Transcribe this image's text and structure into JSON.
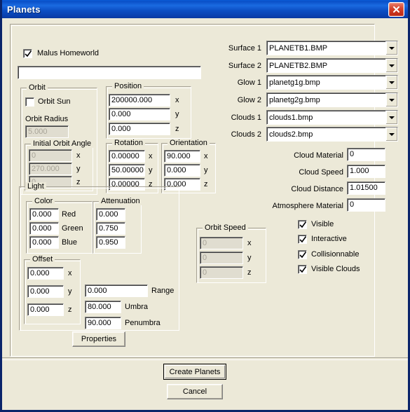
{
  "window": {
    "title": "Planets",
    "close_icon": "close-icon",
    "titlebar_color": "#0a50c8",
    "face_color": "#ece9d8"
  },
  "main": {
    "homeworld_checkbox": {
      "label": "Malus Homeworld",
      "checked": true
    },
    "name_field": {
      "value": "",
      "placeholder": ""
    },
    "orbit": {
      "legend": "Orbit",
      "orbit_sun": {
        "label": "Orbit Sun",
        "checked": false
      },
      "orbit_radius_label": "Orbit Radius",
      "orbit_radius_value": "5.000",
      "orbit_radius_disabled": true,
      "initial_orbit_angle": {
        "legend": "Initial Orbit Angle",
        "disabled": true,
        "axes": [
          "x",
          "y",
          "z"
        ],
        "values": [
          "0",
          "270.000",
          "0"
        ]
      }
    },
    "position": {
      "legend": "Position",
      "axes": [
        "x",
        "y",
        "z"
      ],
      "values": [
        "200000.000",
        "0.000",
        "0.000"
      ]
    },
    "rotation": {
      "legend": "Rotation",
      "axes": [
        "x",
        "y",
        "z"
      ],
      "values": [
        "0.00000",
        "50.00000",
        "0.00000"
      ]
    },
    "orientation": {
      "legend": "Orientation",
      "axes": [
        "x",
        "y",
        "z"
      ],
      "values": [
        "90.000",
        "0.000",
        "0.000"
      ]
    },
    "light": {
      "legend": "Light",
      "color": {
        "legend": "Color",
        "labels": [
          "Red",
          "Green",
          "Blue"
        ],
        "values": [
          "0.000",
          "0.000",
          "0.000"
        ]
      },
      "attenuation": {
        "legend": "Attenuation",
        "values": [
          "0.000",
          "0.750",
          "0.950"
        ]
      },
      "offset": {
        "legend": "Offset",
        "axes": [
          "x",
          "y",
          "z"
        ],
        "values": [
          "0.000",
          "0.000",
          "0.000"
        ]
      },
      "range": {
        "label": "Range",
        "value": "0.000"
      },
      "umbra": {
        "label": "Umbra",
        "value": "80.000"
      },
      "penumbra": {
        "label": "Penumbra",
        "value": "90.000"
      }
    },
    "orbit_speed": {
      "legend": "Orbit Speed",
      "disabled": true,
      "axes": [
        "x",
        "y",
        "z"
      ],
      "values": [
        "0",
        "0",
        "0"
      ]
    },
    "textures": [
      {
        "label": "Surface 1",
        "value": "PLANETB1.BMP"
      },
      {
        "label": "Surface 2",
        "value": "PLANETB2.BMP"
      },
      {
        "label": "Glow 1",
        "value": "planetg1g.bmp"
      },
      {
        "label": "Glow 2",
        "value": "planetg2g.bmp"
      },
      {
        "label": "Clouds 1",
        "value": "clouds1.bmp"
      },
      {
        "label": "Clouds 2",
        "value": "clouds2.bmp"
      }
    ],
    "cloud_params": [
      {
        "label": "Cloud Material",
        "value": "0"
      },
      {
        "label": "Cloud Speed",
        "value": "1.000"
      },
      {
        "label": "Cloud Distance",
        "value": "1.01500"
      },
      {
        "label": "Atmosphere Material",
        "value": "0"
      }
    ],
    "flags": [
      {
        "label": "Visible",
        "checked": true
      },
      {
        "label": "Interactive",
        "checked": true
      },
      {
        "label": "Collisionnable",
        "checked": true
      },
      {
        "label": "Visible Clouds",
        "checked": true
      }
    ],
    "properties_button": "Properties"
  },
  "footer": {
    "create_button": "Create Planets",
    "cancel_button": "Cancel"
  }
}
